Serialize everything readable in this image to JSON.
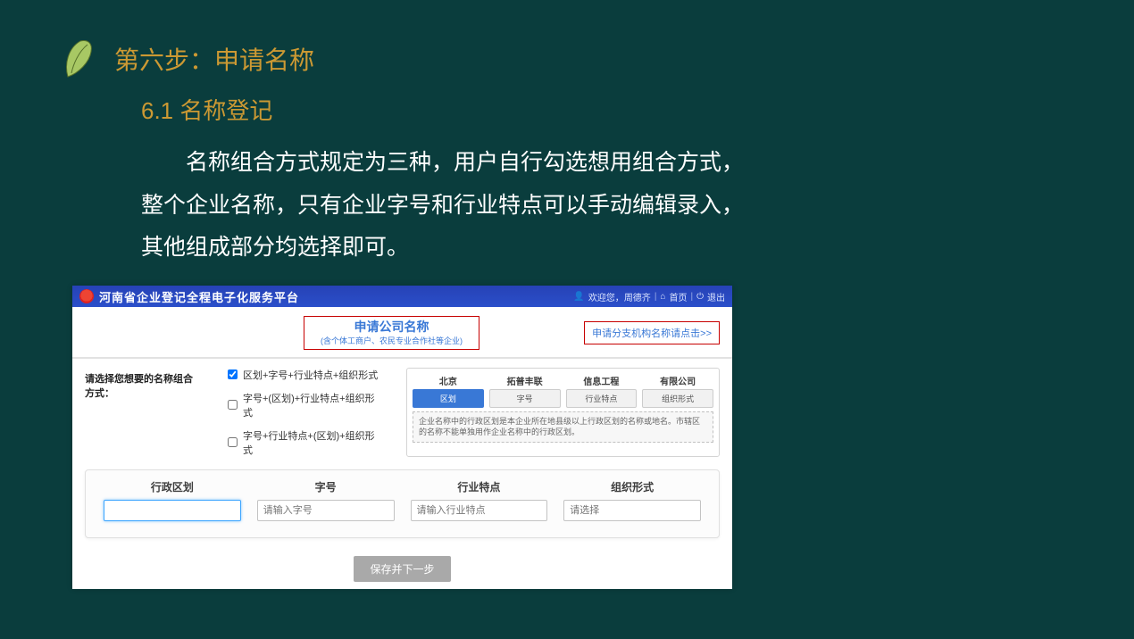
{
  "slide": {
    "step_heading": "第六步：申请名称",
    "sub_heading": "6.1 名称登记",
    "paragraph": "名称组合方式规定为三种，用户自行勾选想用组合方式，整个企业名称，只有企业字号和行业特点可以手动编辑录入，其他组成部分均选择即可。"
  },
  "app": {
    "platform_title": "河南省企业登记全程电子化服务平台",
    "welcome_prefix": "欢迎您，",
    "welcome_user": "周德齐",
    "home": "首页",
    "logout": "退出",
    "title_big": "申请公司名称",
    "title_small": "(含个体工商户、农民专业合作社等企业)",
    "branch_link": "申请分支机构名称请点击>>",
    "options_label": "请选择您想要的名称组合方式：",
    "opt1": "区划+字号+行业特点+组织形式",
    "opt2": "字号+(区划)+行业特点+组织形式",
    "opt3": "字号+行业特点+(区划)+组织形式",
    "preview": {
      "c1_top": "北京",
      "c1_btn": "区划",
      "c2_top": "拓普丰联",
      "c2_btn": "字号",
      "c3_top": "信息工程",
      "c3_btn": "行业特点",
      "c4_top": "有限公司",
      "c4_btn": "组织形式",
      "note": "企业名称中的行政区划是本企业所在地县级以上行政区划的名称或地名。市辖区的名称不能单独用作企业名称中的行政区划。"
    },
    "fields": {
      "f1_label": "行政区划",
      "f1_ph": "",
      "f2_label": "字号",
      "f2_ph": "请输入字号",
      "f3_label": "行业特点",
      "f3_ph": "请输入行业特点",
      "f4_label": "组织形式",
      "f4_ph": "请选择"
    },
    "submit": "保存并下一步"
  }
}
